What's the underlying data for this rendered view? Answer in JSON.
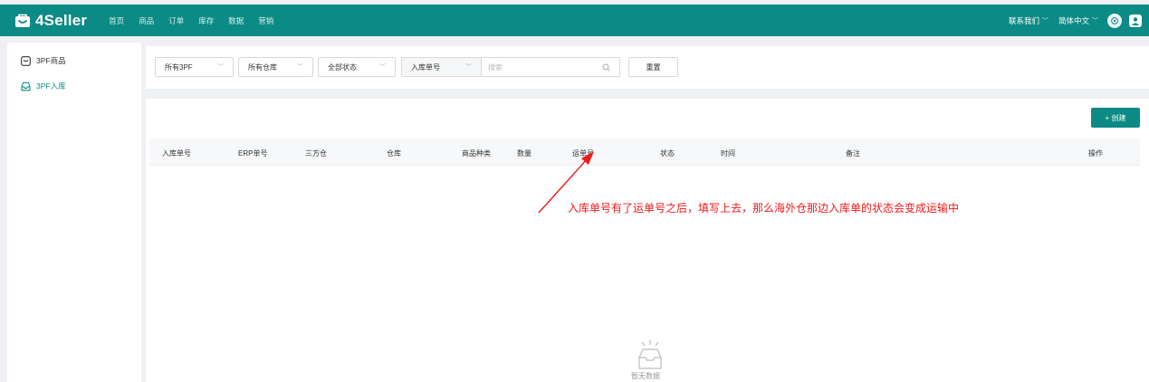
{
  "app": {
    "brand": "4Seller"
  },
  "nav": [
    "首页",
    "商品",
    "订单",
    "库存",
    "数据",
    "营销"
  ],
  "topbar": {
    "contact": "联系我们",
    "language": "简体中文"
  },
  "sidebar": {
    "items": [
      {
        "label": "3PF商品",
        "active": false
      },
      {
        "label": "3PF入库",
        "active": true
      }
    ]
  },
  "filters": {
    "all_3pf": "所有3PF",
    "all_warehouse": "所有仓库",
    "all_status": "全部状态",
    "search_field": "入库单号",
    "search_placeholder": "搜索",
    "reset": "重置"
  },
  "actions": {
    "create": "+ 创建"
  },
  "table": {
    "columns": [
      "入库单号",
      "ERP单号",
      "三方仓",
      "仓库",
      "商品种类",
      "数量",
      "运单号",
      "状态",
      "时间",
      "备注",
      "操作"
    ],
    "rows": [],
    "empty_text": "暂无数据"
  },
  "annotation": {
    "text": "入库单号有了运单号之后，填写上去，那么海外仓那边入库单的状态会变成运输中",
    "color": "#ee1b1b"
  },
  "colors": {
    "primary": "#0c8a85",
    "background": "#eef0f3"
  }
}
